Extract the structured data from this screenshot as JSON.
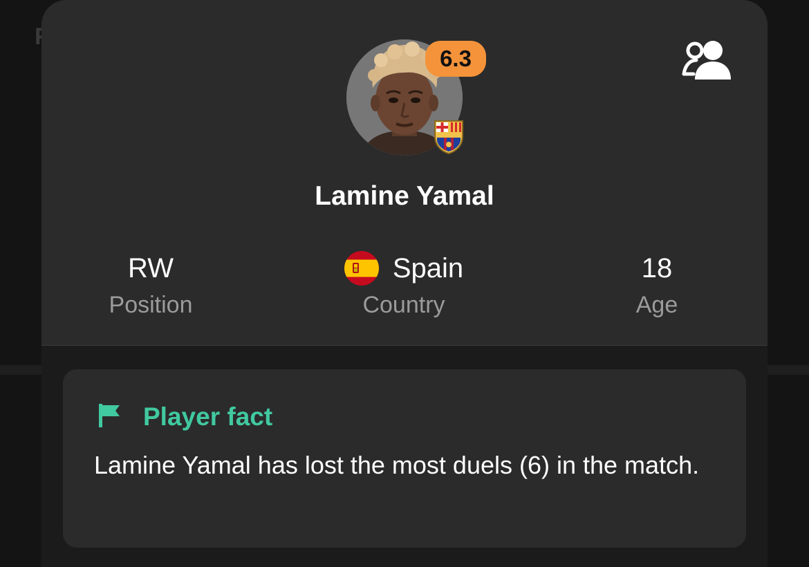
{
  "backdrop": {
    "partial_letter": "F"
  },
  "player": {
    "name": "Lamine Yamal",
    "rating": "6.3",
    "rating_color": "#f4933a",
    "club_icon": "fc-barcelona-crest-icon",
    "follow_icon": "follow-players-icon"
  },
  "stats": {
    "position": {
      "value": "RW",
      "label": "Position"
    },
    "country": {
      "value": "Spain",
      "label": "Country",
      "flag_icon": "spain-flag-icon"
    },
    "age": {
      "value": "18",
      "label": "Age"
    }
  },
  "fact": {
    "title": "Player fact",
    "icon": "flag-icon",
    "text": "Lamine Yamal has lost the most duels (6) in the match.",
    "accent_color": "#41c9a0"
  }
}
